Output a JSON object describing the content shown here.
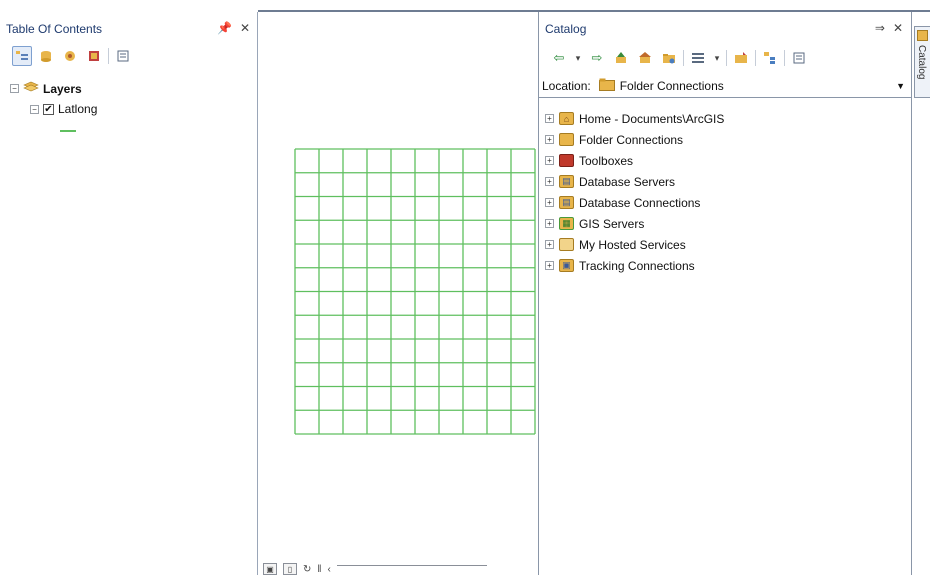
{
  "toc": {
    "title": "Table Of Contents",
    "pin_label": "⁙",
    "close_label": "✕",
    "toolbar_icons": [
      "list-by-drawing-order-icon",
      "list-by-source-icon",
      "list-by-visibility-icon",
      "list-by-selection-icon",
      "options-icon"
    ],
    "tree": [
      {
        "label": "Layers",
        "expander": "−",
        "bold": true
      },
      {
        "label": "Latlong",
        "expander": "−",
        "checked": true
      }
    ]
  },
  "map": {
    "grid_columns": 10,
    "grid_rows": 12,
    "grid_color": "#5fbf5f",
    "controls": [
      "layout-view-icon",
      "data-view-icon",
      "refresh-icon",
      "pause-icon",
      "scroll-left-icon"
    ]
  },
  "catalog": {
    "title": "Catalog",
    "pin_label": "⁙",
    "close_label": "✕",
    "toolbar_icons": [
      "back-icon",
      "dropdown-icon",
      "forward-icon",
      "up-one-level-icon",
      "home-icon",
      "connect-folder-icon",
      "views-icon",
      "views-dropdown-icon",
      "new-icon",
      "toggle-tree-icon",
      "options-icon"
    ],
    "location_label": "Location:",
    "location_value": "Folder Connections",
    "tree": [
      {
        "label": "Home - Documents\\ArcGIS",
        "icon": "home-folder-icon",
        "color": "#e8b54a"
      },
      {
        "label": "Folder Connections",
        "icon": "folder-connections-icon",
        "color": "#e8b54a"
      },
      {
        "label": "Toolboxes",
        "icon": "toolbox-icon",
        "color": "#c0392b"
      },
      {
        "label": "Database Servers",
        "icon": "database-server-icon",
        "color": "#e8b54a"
      },
      {
        "label": "Database Connections",
        "icon": "database-connection-icon",
        "color": "#e8b54a"
      },
      {
        "label": "GIS Servers",
        "icon": "gis-server-icon",
        "color": "#4a9a3a"
      },
      {
        "label": "My Hosted Services",
        "icon": "hosted-services-icon",
        "color": "#e8b54a"
      },
      {
        "label": "Tracking Connections",
        "icon": "tracking-connections-icon",
        "color": "#e8b54a"
      }
    ]
  },
  "side_tab": {
    "label": "Catalog"
  }
}
